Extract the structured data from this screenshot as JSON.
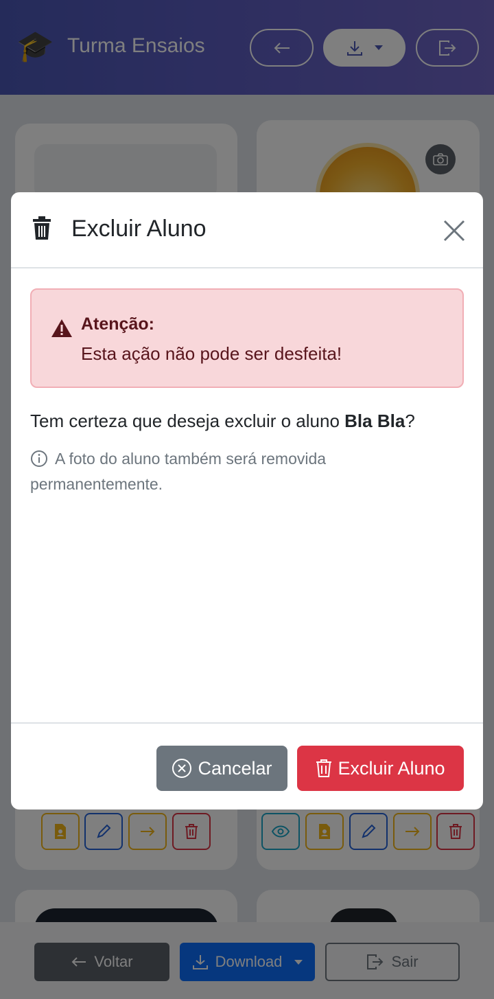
{
  "header": {
    "app_title": "Turma Ensaios",
    "logo_icon": "graduation-cap-icon",
    "buttons": [
      "back-arrow-icon",
      "download-icon",
      "logout-icon"
    ]
  },
  "bottom_bar": {
    "voltar_label": "Voltar",
    "download_label": "Download",
    "sair_label": "Sair"
  },
  "modal": {
    "title": "Excluir Aluno",
    "alert_title": "Atenção:",
    "alert_text": "Esta ação não pode ser desfeita!",
    "question_prefix": "Tem certeza que deseja excluir o aluno ",
    "student_name": "Bla Bla",
    "question_suffix": "?",
    "info_text": "A foto do aluno também será removida permanentemente.",
    "cancel_label": "Cancelar",
    "delete_label": "Excluir Aluno"
  },
  "colors": {
    "header_gradient_start": "#4a57b5",
    "danger": "#dc3545",
    "secondary": "#6c757d",
    "primary": "#0d6efd",
    "alert_bg": "#f8d7da",
    "alert_text": "#58151c"
  }
}
